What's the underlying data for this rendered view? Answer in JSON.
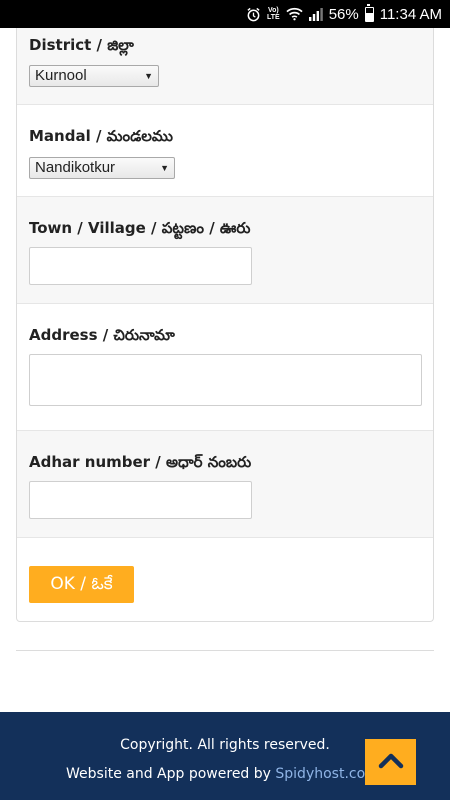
{
  "status_bar": {
    "volte_label": "Vo)",
    "lte_label": "LTE",
    "battery": "56%",
    "battery_level": 0.56,
    "time": "11:34 AM",
    "icons": [
      "alarm-icon",
      "wifi-icon",
      "signal-icon",
      "battery-icon"
    ]
  },
  "form": {
    "district": {
      "label": "District / జిల్లా",
      "selected": "Kurnool"
    },
    "mandal": {
      "label": "Mandal / మండలము",
      "selected": "Nandikotkur"
    },
    "town": {
      "label": "Town / Village / పట్టణం / ఊరు",
      "value": ""
    },
    "address": {
      "label": "Address / చిరునామా",
      "value": ""
    },
    "adhar": {
      "label": "Adhar number / అధార్ నంబరు",
      "value": ""
    },
    "ok_label": "OK / ఓకే"
  },
  "footer": {
    "copyright": "Copyright. All rights reserved.",
    "powered_prefix": "Website and App powered by ",
    "powered_brand": "Spidyhost.co"
  },
  "colors": {
    "accent": "#ffad1f",
    "footer_bg": "#13305a",
    "status_bar": "#000000"
  }
}
